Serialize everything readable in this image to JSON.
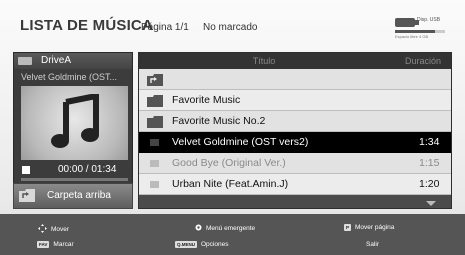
{
  "header": {
    "title": "LISTA DE MÚSICA",
    "page_indicator": "Página 1/1",
    "marked_status": "No marcado",
    "usb": {
      "label": "Disp. USB",
      "space_text": "Espacio libre 4 GB",
      "used_fraction": 0.8
    }
  },
  "preview": {
    "drive_label": "DriveA",
    "track_name": "Velvet Goldmine (OST...",
    "time": "00:00 / 01:34",
    "progress_fraction": 0.0,
    "up_label": "Carpeta arriba"
  },
  "list": {
    "column_title": "Título",
    "column_duration": "Duración",
    "rows": [
      {
        "type": "parent-folder",
        "title": "",
        "duration": ""
      },
      {
        "type": "folder",
        "title": "Favorite Music",
        "duration": ""
      },
      {
        "type": "folder",
        "title": "Favorite Music No.2",
        "duration": ""
      },
      {
        "type": "file",
        "title": "Velvet Goldmine (OST vers2)",
        "duration": "1:34",
        "selected": true
      },
      {
        "type": "file",
        "title": "Good Bye (Original Ver.)",
        "duration": "1:15",
        "dim": true
      },
      {
        "type": "file",
        "title": "Urban Nite (Feat.Amin.J)",
        "duration": "1:20"
      }
    ]
  },
  "footer": {
    "move": "Mover",
    "popup_menu": "Menú emergente",
    "move_page": "Mover página",
    "mark": "Marcar",
    "options": "Opciones",
    "exit": "Salir",
    "mark_key": "FAV",
    "options_key": "Q.MENU",
    "page_key": "P"
  },
  "colors": {
    "selected_row": "#000000",
    "folder": "#555555"
  }
}
